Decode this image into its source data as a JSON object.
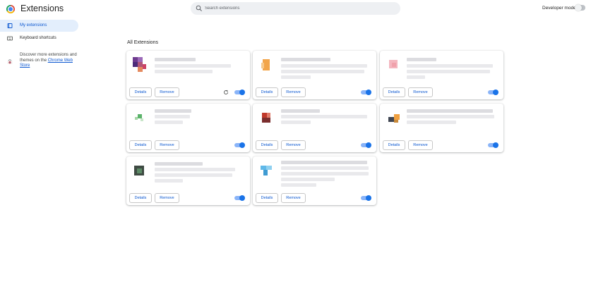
{
  "header": {
    "title": "Extensions",
    "search_placeholder": "Search extensions",
    "developer_mode_label": "Developer mode",
    "developer_mode_on": false
  },
  "sidebar": {
    "items": [
      {
        "label": "My extensions",
        "icon": "extensions-icon",
        "active": true
      },
      {
        "label": "Keyboard shortcuts",
        "icon": "keyboard-icon",
        "active": false
      }
    ],
    "promo_text": "Discover more extensions and themes on the ",
    "promo_link": "Chrome Web Store"
  },
  "main": {
    "section_title": "All Extensions",
    "details_label": "Details",
    "remove_label": "Remove",
    "cards": [
      {
        "enabled": true,
        "has_reload": true
      },
      {
        "enabled": true,
        "has_reload": false
      },
      {
        "enabled": true,
        "has_reload": false
      },
      {
        "enabled": true,
        "has_reload": false
      },
      {
        "enabled": true,
        "has_reload": false
      },
      {
        "enabled": true,
        "has_reload": false
      },
      {
        "enabled": true,
        "has_reload": false
      },
      {
        "enabled": true,
        "has_reload": false
      }
    ]
  },
  "colors": {
    "accent": "#0b57d0",
    "toggle_on": "#1a73e8",
    "sidebar_active_bg": "#e3eefc"
  }
}
